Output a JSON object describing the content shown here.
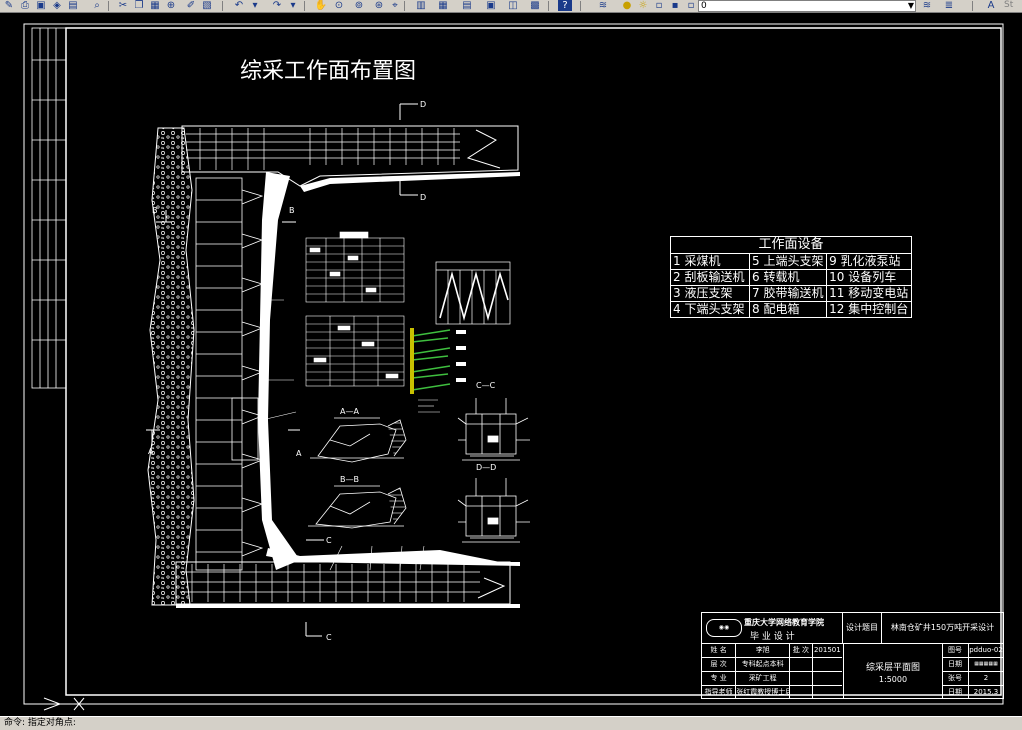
{
  "toolbar": {
    "layer_value": "0",
    "right_text": "St"
  },
  "drawing": {
    "title": "综采工作面布置图",
    "section_labels": {
      "D_top": "D",
      "D_mid": "D",
      "B_left": "B",
      "B_right": "B",
      "A_left": "A",
      "A_right": "A",
      "C_top": "C",
      "C_bottom": "C",
      "aa": "A—A",
      "bb": "B—B",
      "cc": "C—C",
      "dd": "D—D"
    }
  },
  "equipment_table": {
    "title": "工作面设备",
    "rows": [
      [
        "1  采煤机",
        "5  上端头支架",
        "9  乳化液泵站"
      ],
      [
        "2  刮板输送机",
        "6  转载机",
        "10 设备列车"
      ],
      [
        "3  液压支架",
        "7  胶带输送机",
        "11 移动变电站"
      ],
      [
        "4  下端头支架",
        "8  配电箱",
        "12 集中控制台"
      ]
    ]
  },
  "title_block": {
    "school": "重庆大学网络教育学院",
    "design_type": "毕  业  设  计",
    "project_label": "设计题目",
    "project_title": "林南仓矿井150万吨开采设计",
    "drawing_name": "综采层平面图",
    "scale": "1:5000",
    "no_label": "图号",
    "no_value": "pdduo-02",
    "cat_label": "日期",
    "sheet_label": "张号",
    "sheet_value": "2",
    "date_label": "日期",
    "date_value": "2015.3",
    "rows": [
      [
        "姓 名",
        "李旭",
        "批 次",
        "201501"
      ],
      [
        "层 次",
        "专科起点本科",
        "",
        ""
      ],
      [
        "专 业",
        "采矿工程",
        "",
        ""
      ],
      [
        "指导老师",
        "张红霞教授博士后",
        "",
        ""
      ]
    ]
  },
  "status": {
    "text": "命令: 指定对角点:"
  }
}
